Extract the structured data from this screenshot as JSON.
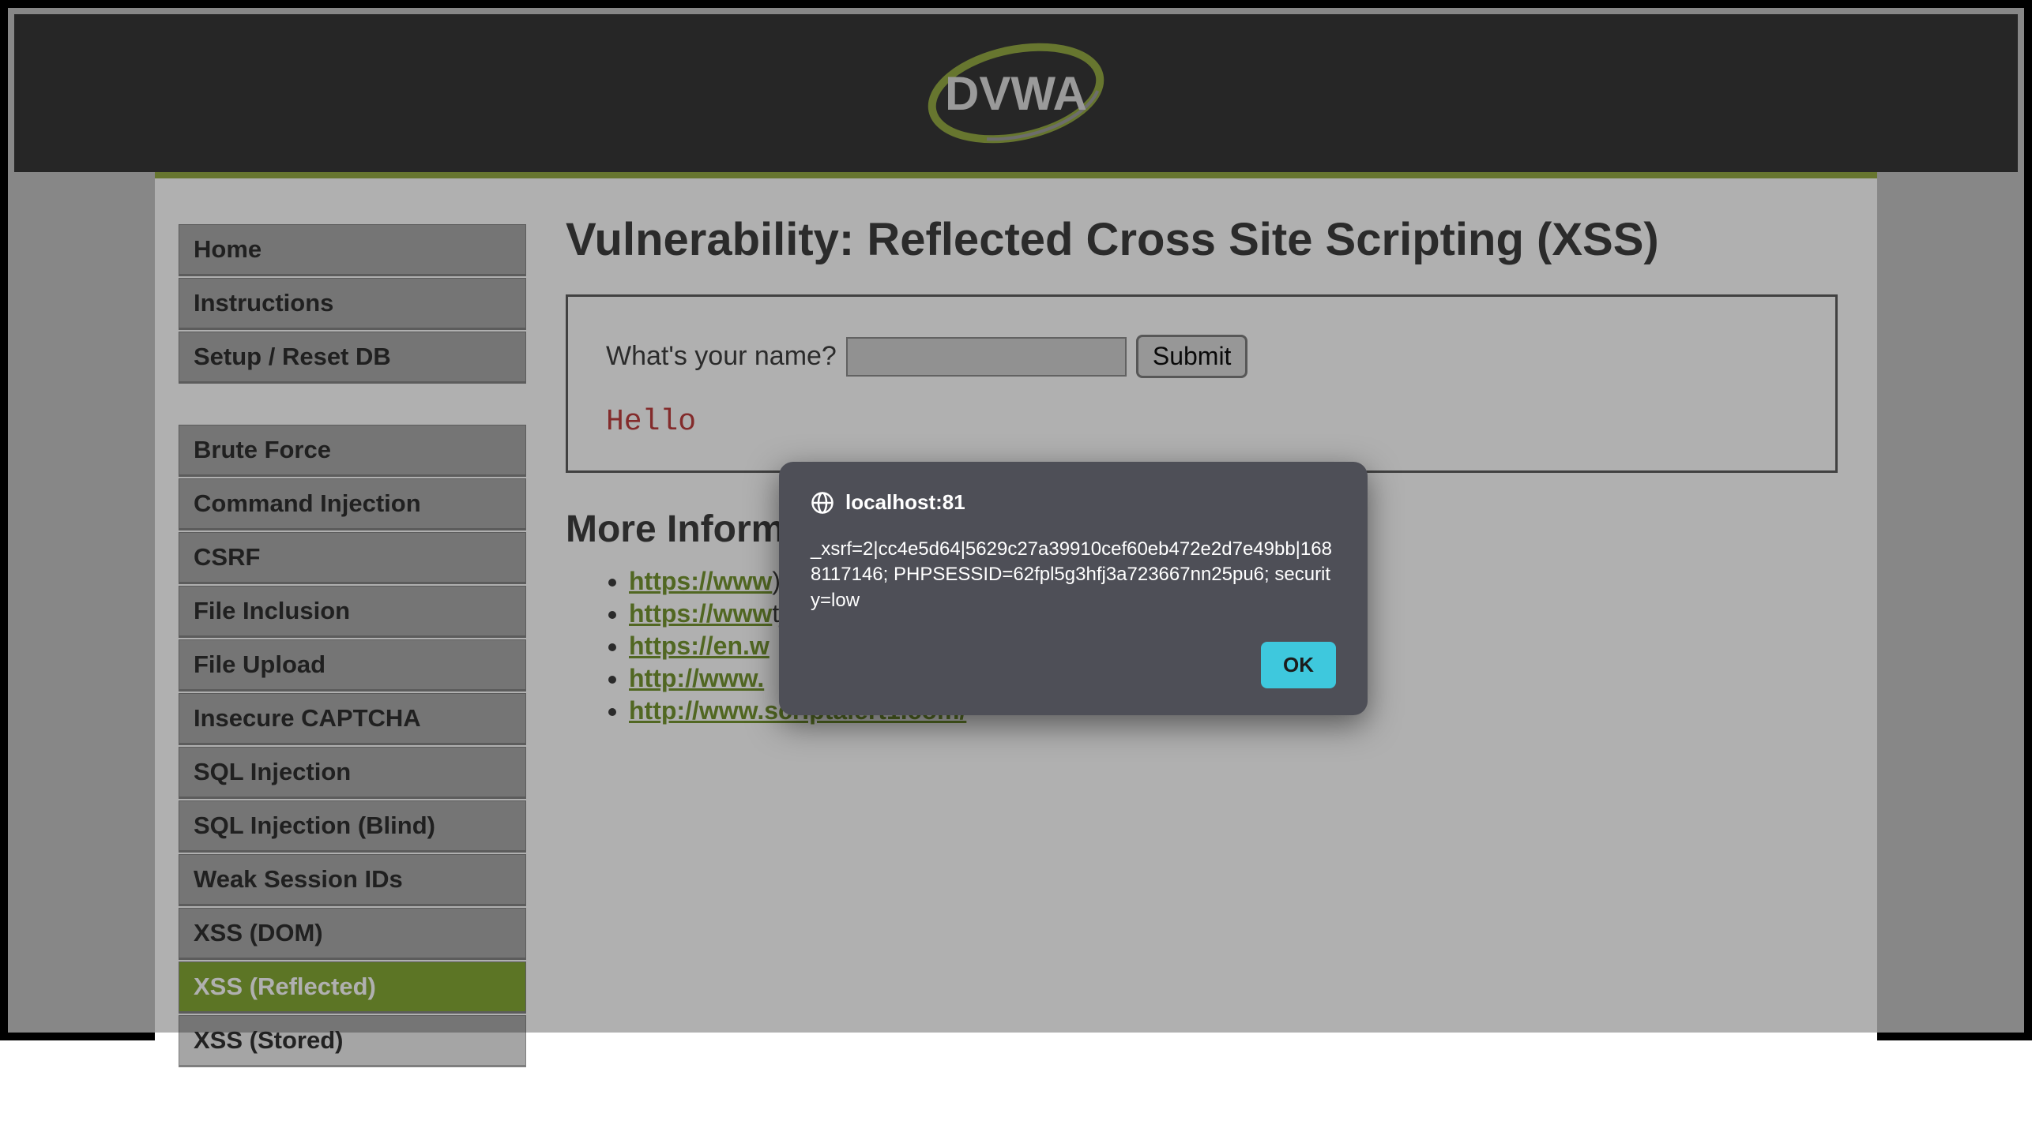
{
  "logo": {
    "text": "DVWA"
  },
  "sidebar": {
    "groups": [
      [
        {
          "label": "Home"
        },
        {
          "label": "Instructions"
        },
        {
          "label": "Setup / Reset DB"
        }
      ],
      [
        {
          "label": "Brute Force"
        },
        {
          "label": "Command Injection"
        },
        {
          "label": "CSRF"
        },
        {
          "label": "File Inclusion"
        },
        {
          "label": "File Upload"
        },
        {
          "label": "Insecure CAPTCHA"
        },
        {
          "label": "SQL Injection"
        },
        {
          "label": "SQL Injection (Blind)"
        },
        {
          "label": "Weak Session IDs"
        },
        {
          "label": "XSS (DOM)"
        },
        {
          "label": "XSS (Reflected)",
          "active": true
        },
        {
          "label": "XSS (Stored)"
        }
      ]
    ]
  },
  "main": {
    "title": "Vulnerability: Reflected Cross Site Scripting (XSS)",
    "form": {
      "label": "What's your name?",
      "input_value": "",
      "submit_label": "Submit"
    },
    "output": "Hello",
    "more_heading": "More Information",
    "links": [
      {
        "text": "https://www",
        "tail": ")"
      },
      {
        "text": "https://www",
        "tail": "t_Sheet"
      },
      {
        "text": "https://en.w",
        "tail": ""
      },
      {
        "text": "http://www.",
        "tail": ""
      },
      {
        "text": "http://www.scriptalert1.com/",
        "tail": ""
      }
    ]
  },
  "alert": {
    "origin": "localhost:81",
    "message": "_xsrf=2|cc4e5d64|5629c27a39910cef60eb472e2d7e49bb|1688117146; PHPSESSID=62fpl5g3hfj3a723667nn25pu6; security=low",
    "ok_label": "OK"
  }
}
